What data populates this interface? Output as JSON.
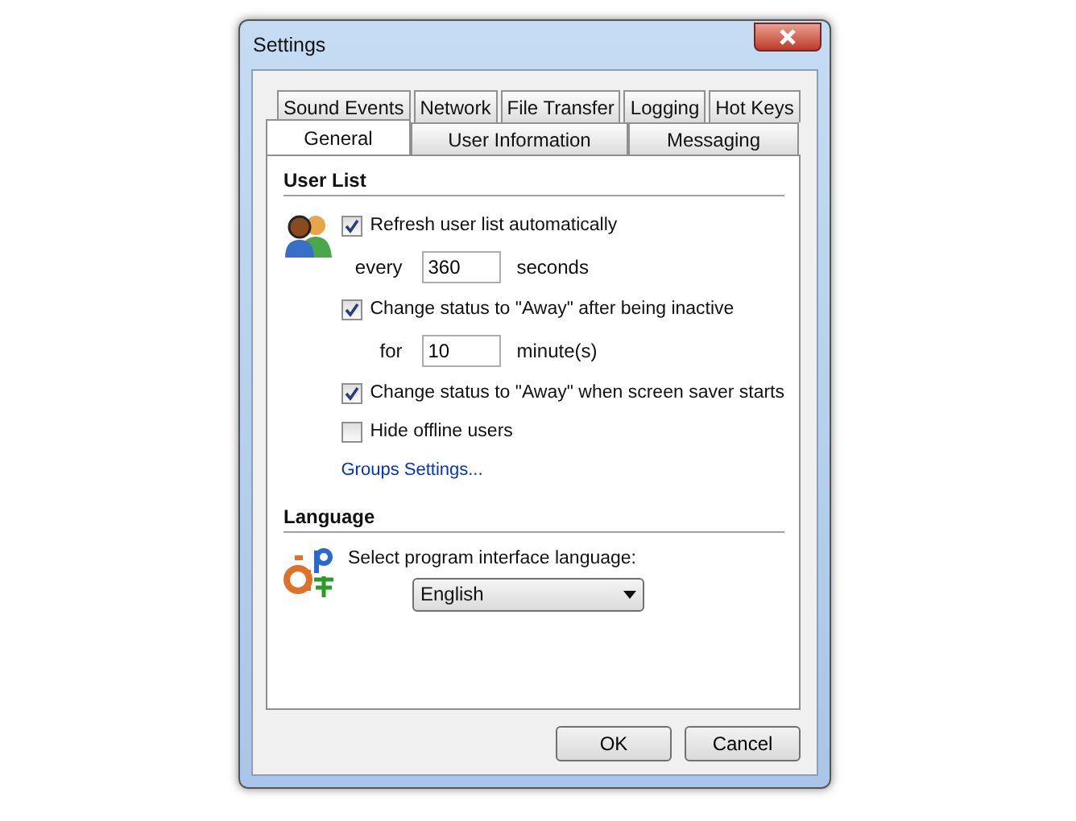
{
  "window": {
    "title": "Settings"
  },
  "tab_rows": [
    [
      {
        "label": "Sound Events",
        "selected": false
      },
      {
        "label": "Network",
        "selected": false
      },
      {
        "label": "File Transfer",
        "selected": false
      },
      {
        "label": "Logging",
        "selected": false
      },
      {
        "label": "Hot Keys",
        "selected": false
      }
    ],
    [
      {
        "label": "General",
        "selected": true
      },
      {
        "label": "User Information",
        "selected": false
      },
      {
        "label": "Messaging",
        "selected": false
      }
    ]
  ],
  "sections": [
    {
      "title": "User List",
      "items": [
        {
          "kind": "checkbox",
          "label": "Refresh user list automatically",
          "checked": true
        },
        {
          "kind": "field",
          "label": "every",
          "value": "360",
          "unit": "seconds"
        },
        {
          "kind": "checkbox",
          "label": "Change status to \"Away\" after being inactive",
          "checked": true
        },
        {
          "kind": "field",
          "label": "for",
          "value": "10",
          "unit": "minute(s)"
        },
        {
          "kind": "checkbox",
          "label": "Change status to \"Away\" when screen saver starts",
          "checked": true
        },
        {
          "kind": "checkbox",
          "label": "Hide offline users",
          "checked": false
        },
        {
          "kind": "link",
          "label": "Groups Settings..."
        }
      ]
    },
    {
      "title": "Language",
      "items": [
        {
          "kind": "text",
          "label": "Select program interface language:"
        },
        {
          "kind": "dropdown",
          "value": "English"
        }
      ]
    }
  ],
  "buttons": [
    "OK",
    "Cancel"
  ]
}
